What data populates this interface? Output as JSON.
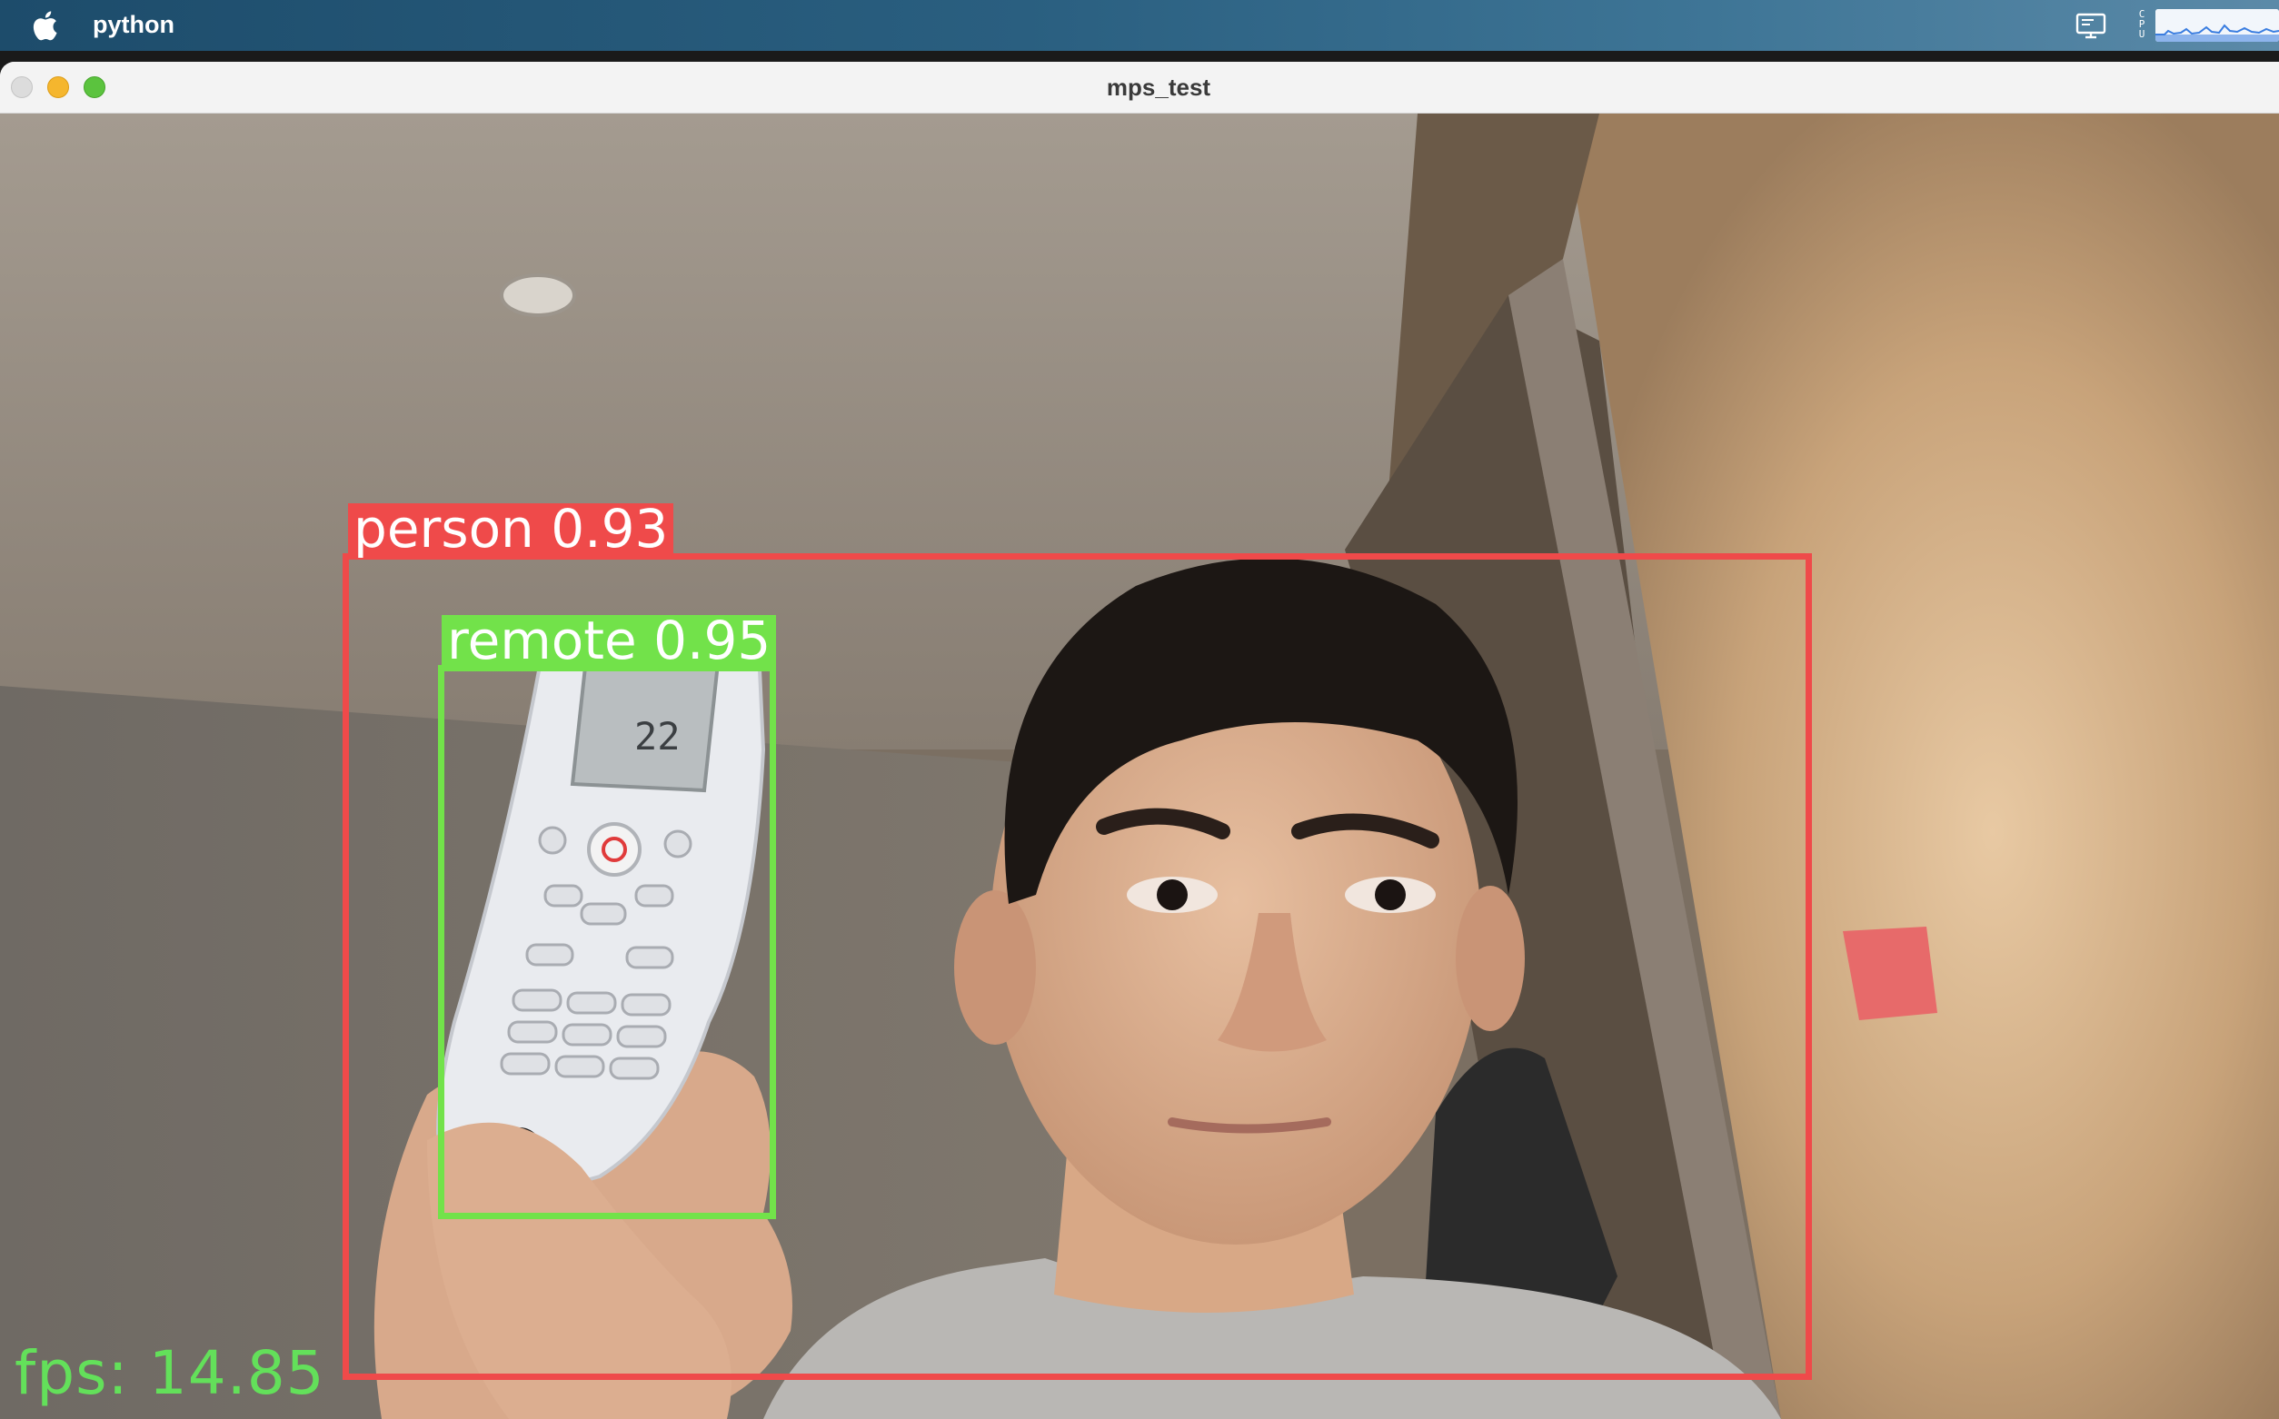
{
  "menubar": {
    "app_name": "python",
    "apple_icon": "apple-logo-icon",
    "status_icons": [
      "display-icon",
      "cpu-graph-icon"
    ],
    "cpu_label": "C P U"
  },
  "window": {
    "title": "mps_test",
    "buttons": [
      "close",
      "minimize",
      "maximize"
    ]
  },
  "detections": [
    {
      "label": "person",
      "score": "0.93",
      "text": "person 0.93",
      "color": "#ef4a4a"
    },
    {
      "label": "remote",
      "score": "0.95",
      "text": "remote 0.95",
      "color": "#72e24a"
    }
  ],
  "overlay": {
    "fps_text": "fps: 14.85",
    "fps_color": "#63e05a"
  }
}
